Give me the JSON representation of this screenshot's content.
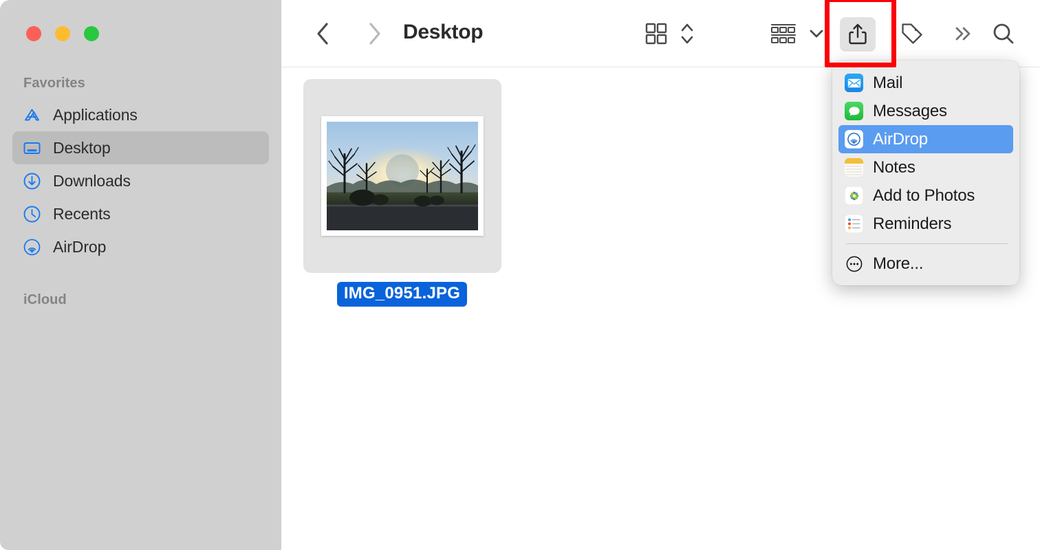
{
  "window": {
    "title": "Desktop",
    "traffic_lights": [
      {
        "name": "close",
        "color": "#fc5f57"
      },
      {
        "name": "minimize",
        "color": "#fdbc2e"
      },
      {
        "name": "maximize",
        "color": "#29c840"
      }
    ]
  },
  "sidebar": {
    "sections": [
      {
        "title": "Favorites",
        "items": [
          {
            "label": "Applications",
            "icon": "applications-icon",
            "selected": false
          },
          {
            "label": "Desktop",
            "icon": "desktop-icon",
            "selected": true
          },
          {
            "label": "Downloads",
            "icon": "downloads-icon",
            "selected": false
          },
          {
            "label": "Recents",
            "icon": "recents-clock-icon",
            "selected": false
          },
          {
            "label": "AirDrop",
            "icon": "airdrop-icon",
            "selected": false
          }
        ]
      },
      {
        "title": "iCloud",
        "items": []
      }
    ]
  },
  "toolbar": {
    "back_label": "Back",
    "forward_label": "Forward",
    "path_title": "Desktop",
    "view_group_label": "Icon View",
    "view_stepper_label": "Change view",
    "group_label": "Group items",
    "group_chevron_label": "Group options",
    "share_label": "Share",
    "tag_label": "Edit tags",
    "more_label": "More toolbar items",
    "search_label": "Search",
    "highlight_color": "#fb0007"
  },
  "content": {
    "files": [
      {
        "name": "IMG_0951.JPG",
        "selected": true,
        "kind": "image-thumbnail"
      }
    ],
    "selection_color": "#0a63da"
  },
  "share_menu": {
    "highlight_color": "#5a9cf0",
    "items": [
      {
        "label": "Mail",
        "icon": "mail-app-icon",
        "highlighted": false
      },
      {
        "label": "Messages",
        "icon": "messages-app-icon",
        "highlighted": false
      },
      {
        "label": "AirDrop",
        "icon": "airdrop-app-icon",
        "highlighted": true
      },
      {
        "label": "Notes",
        "icon": "notes-app-icon",
        "highlighted": false
      },
      {
        "label": "Add to Photos",
        "icon": "photos-app-icon",
        "highlighted": false
      },
      {
        "label": "Reminders",
        "icon": "reminders-app-icon",
        "highlighted": false
      }
    ],
    "more_label": "More..."
  }
}
